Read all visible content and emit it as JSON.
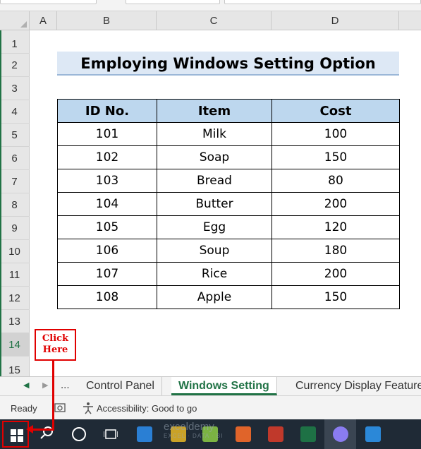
{
  "columns": [
    "A",
    "B",
    "C",
    "D"
  ],
  "rows": [
    "1",
    "2",
    "3",
    "4",
    "5",
    "6",
    "7",
    "8",
    "9",
    "10",
    "11",
    "12",
    "13",
    "14",
    "15"
  ],
  "title": "Employing Windows Setting Option",
  "table": {
    "headers": [
      "ID No.",
      "Item",
      "Cost"
    ],
    "rows": [
      [
        "101",
        "Milk",
        "100"
      ],
      [
        "102",
        "Soap",
        "150"
      ],
      [
        "103",
        "Bread",
        "80"
      ],
      [
        "104",
        "Butter",
        "200"
      ],
      [
        "105",
        "Egg",
        "120"
      ],
      [
        "106",
        "Soup",
        "180"
      ],
      [
        "107",
        "Rice",
        "200"
      ],
      [
        "108",
        "Apple",
        "150"
      ]
    ]
  },
  "callout": {
    "line1": "Click",
    "line2": "Here"
  },
  "tabs": {
    "overflow": "...",
    "t1": "Control Panel",
    "t2": "Windows Setting",
    "t3": "Currency Display Features"
  },
  "status": {
    "ready": "Ready",
    "accessibility": "Accessibility: Good to go"
  },
  "watermark": {
    "name": "exceldemy",
    "tag": "EXCEL · DATA · BI"
  },
  "colors": {
    "excel_green": "#217346",
    "header_fill": "#bdd7ee",
    "title_fill": "#dde8f5",
    "annotation_red": "#e00000"
  }
}
